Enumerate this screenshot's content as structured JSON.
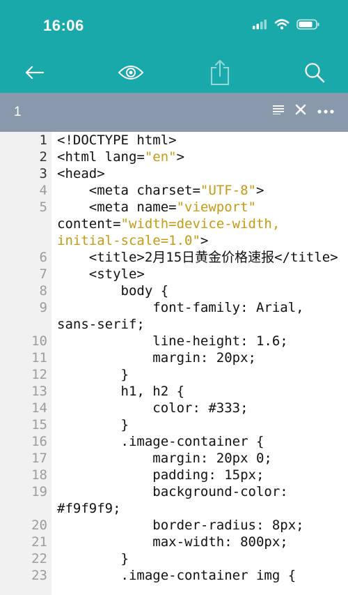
{
  "status_bar": {
    "time": "16:06"
  },
  "toolbar": {
    "back_icon": "arrow-left-icon",
    "preview_icon": "eye-icon",
    "share_icon": "share-icon",
    "search_icon": "search-icon"
  },
  "tab": {
    "title": "1",
    "format_icon": "lines-icon",
    "close_icon": "close-icon",
    "more_icon": "more-icon"
  },
  "editor": {
    "lines": [
      {
        "n": "1",
        "t": "<!DOCTYPE html>"
      },
      {
        "n": "2",
        "t": "<html lang=\"en\">"
      },
      {
        "n": "3",
        "t": "<head>"
      },
      {
        "n": "4",
        "t": "    <meta charset=\"UTF-8\">"
      },
      {
        "n": "5",
        "t": "    <meta name=\"viewport\" content=\"width=device-width, initial-scale=1.0\">"
      },
      {
        "n": "6",
        "t": "    <title>2月15日黄金价格速报</title>"
      },
      {
        "n": "7",
        "t": "    <style>"
      },
      {
        "n": "8",
        "t": "        body {"
      },
      {
        "n": "9",
        "t": "            font-family: Arial, sans-serif;"
      },
      {
        "n": "10",
        "t": "            line-height: 1.6;"
      },
      {
        "n": "11",
        "t": "            margin: 20px;"
      },
      {
        "n": "12",
        "t": "        }"
      },
      {
        "n": "13",
        "t": "        h1, h2 {"
      },
      {
        "n": "14",
        "t": "            color: #333;"
      },
      {
        "n": "15",
        "t": "        }"
      },
      {
        "n": "16",
        "t": "        .image-container {"
      },
      {
        "n": "17",
        "t": "            margin: 20px 0;"
      },
      {
        "n": "18",
        "t": "            padding: 15px;"
      },
      {
        "n": "19",
        "t": "            background-color: #f9f9f9;"
      },
      {
        "n": "20",
        "t": "            border-radius: 8px;"
      },
      {
        "n": "21",
        "t": "            max-width: 800px;"
      },
      {
        "n": "22",
        "t": "        }"
      },
      {
        "n": "23",
        "t": "        .image-container img {"
      }
    ]
  }
}
